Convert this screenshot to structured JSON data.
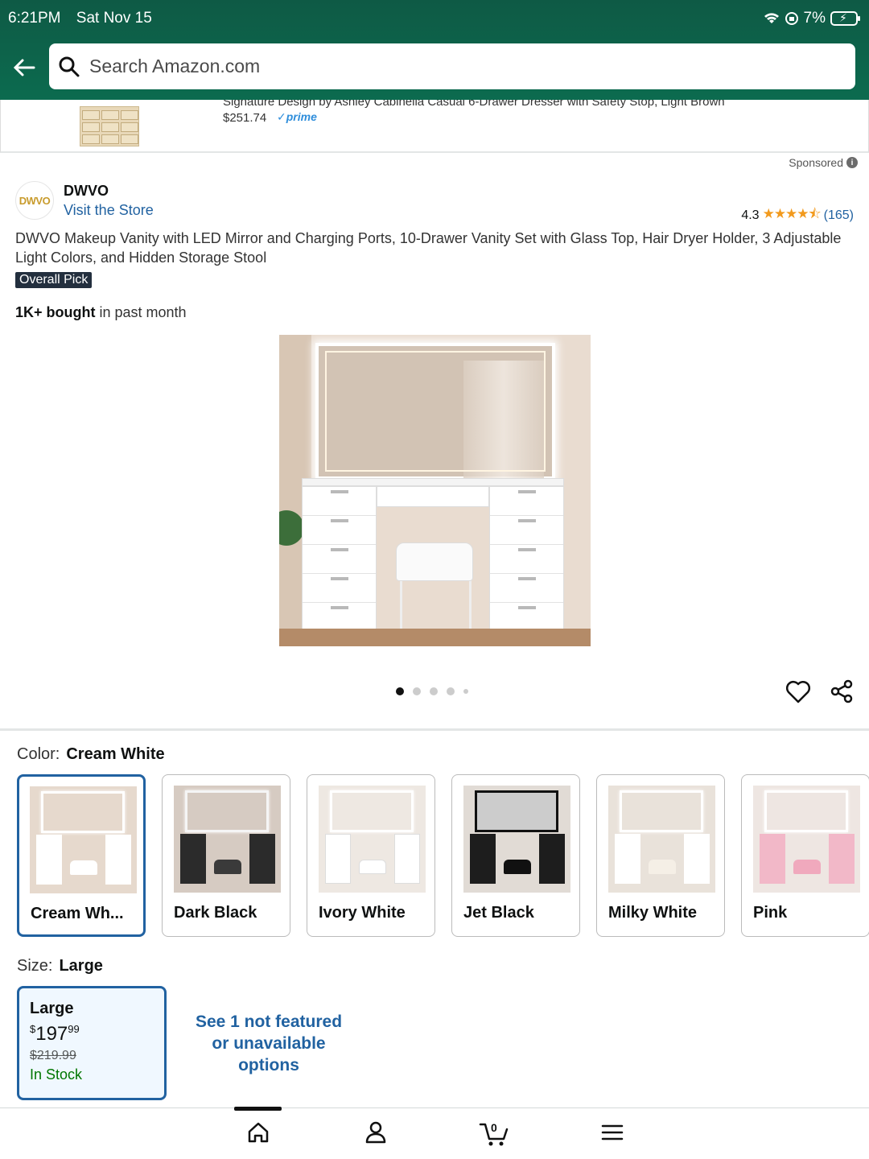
{
  "status_bar": {
    "time": "6:21PM",
    "date": "Sat Nov 15",
    "battery": "7%"
  },
  "search": {
    "placeholder": "Search Amazon.com"
  },
  "sponsored_strip": {
    "title": "Signature Design by Ashley Cabinella Casual 6-Drawer Dresser with Safety Stop, Light Brown",
    "price": "$251.74",
    "prime_label": "prime"
  },
  "sponsored_label": "Sponsored",
  "product": {
    "brand": "DWVO",
    "brand_logo_text": "DWVO",
    "visit_store": "Visit the Store",
    "rating_value": "4.3",
    "rating_stars": 4.3,
    "rating_count": "(165)",
    "title": "DWVO Makeup Vanity with LED Mirror and Charging Ports, 10-Drawer Vanity Set with Glass Top, Hair Dryer Holder, 3 Adjustable Light Colors, and Hidden Storage Stool",
    "badge": "Overall Pick",
    "bought_bold": "1K+ bought",
    "bought_rest": " in past month",
    "image_count": 5,
    "image_index": 1
  },
  "color": {
    "label": "Color:",
    "selected": "Cream White",
    "options": [
      "Cream Wh...",
      "Dark Black",
      "Ivory White",
      "Jet Black",
      "Milky White",
      "Pink"
    ],
    "swatch_colors": [
      "#ffffff",
      "#2b2b2b",
      "#ffffff",
      "#1d1d1d",
      "#ffffff",
      "#f2b8c8"
    ]
  },
  "size": {
    "label": "Size:",
    "selected": "Large",
    "card": {
      "name": "Large",
      "price_symbol": "$",
      "price_whole": "197",
      "price_fraction": "99",
      "list_price": "$219.99",
      "stock": "In Stock"
    },
    "not_featured": "See 1 not featured or unavailable options"
  },
  "bottom_nav": {
    "items": [
      "home-icon",
      "account-icon",
      "cart-icon",
      "menu-icon"
    ],
    "cart_count": "0"
  }
}
